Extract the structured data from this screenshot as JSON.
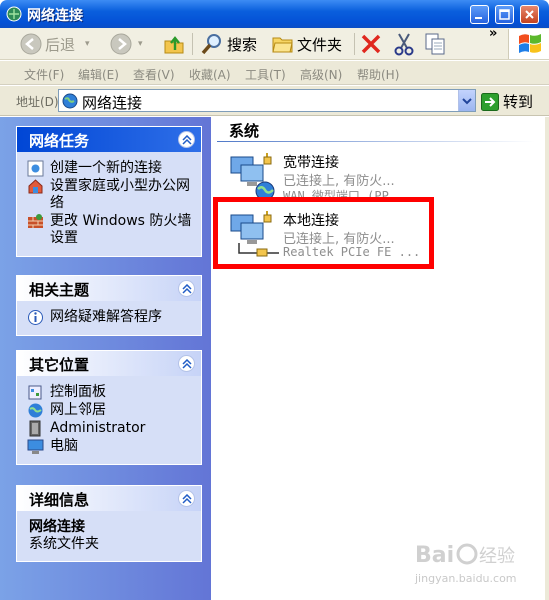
{
  "window": {
    "title": "网络连接"
  },
  "toolbar": {
    "back_label": "后退",
    "search_label": "搜索",
    "folders_label": "文件夹"
  },
  "menu": {
    "items": [
      "文件(F)",
      "编辑(E)",
      "查看(V)",
      "收藏(A)",
      "工具(T)",
      "高级(N)",
      "帮助(H)"
    ]
  },
  "address": {
    "label": "地址(D)",
    "value": "网络连接",
    "go_label": "转到"
  },
  "tasks": {
    "network_tasks": {
      "title": "网络任务",
      "items": [
        "创建一个新的连接",
        "设置家庭或小型办公网络",
        "更改 Windows 防火墙设置"
      ]
    },
    "related_topics": {
      "title": "相关主题",
      "items": [
        "网络疑难解答程序"
      ]
    },
    "other_places": {
      "title": "其它位置",
      "items": [
        "控制面板",
        "网上邻居",
        "Administrator",
        "电脑"
      ]
    },
    "details": {
      "title": "详细信息",
      "name": "网络连接",
      "type": "系统文件夹"
    }
  },
  "content": {
    "group_title": "系统",
    "connections": [
      {
        "name": "宽带连接",
        "status": "已连接上, 有防火...",
        "device": "WAN 微型端口 (PP..."
      },
      {
        "name": "本地连接",
        "status": "已连接上, 有防火...",
        "device": "Realtek PCIe FE ..."
      }
    ]
  },
  "colors": {
    "highlight": "#ff0000",
    "task_pane": "#7ba2e7",
    "title_bar": "#0a5fdd"
  },
  "watermark": {
    "text": "jingyan.baidu.com"
  }
}
